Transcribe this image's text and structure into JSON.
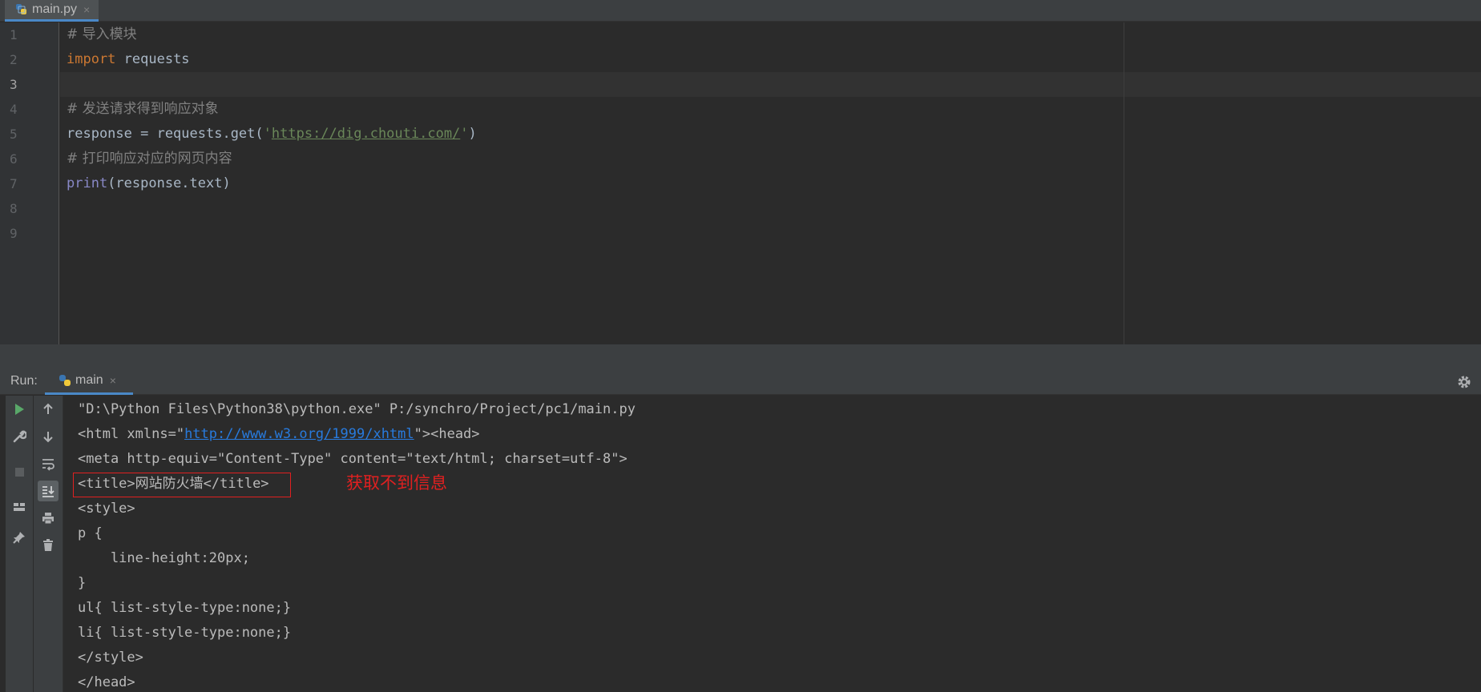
{
  "editor_tab": {
    "filename": "main.py",
    "close_glyph": "×",
    "icon": "python-file-icon"
  },
  "editor": {
    "line_numbers": [
      "1",
      "2",
      "3",
      "4",
      "5",
      "6",
      "7",
      "8",
      "9"
    ],
    "lines": {
      "l1_comment": "# 导入模块",
      "l2_kw": "import",
      "l2_rest": " requests",
      "l4_comment": "# 发送请求得到响应对象",
      "l5_pre": "response = requests.get(",
      "l5_quote_open": "'",
      "l5_url": "https://dig.chouti.com/",
      "l5_quote_close": "'",
      "l5_post": ")",
      "l6_comment": "# 打印响应对应的网页内容",
      "l7_builtin": "print",
      "l7_rest": "(response.text)"
    }
  },
  "run_panel": {
    "label": "Run:",
    "tab_name": "main",
    "close_glyph": "×",
    "settings_icon": "gear-icon"
  },
  "console": {
    "l1": "\"D:\\Python Files\\Python38\\python.exe\" P:/synchro/Project/pc1/main.py",
    "l2_pre": "<html xmlns=\"",
    "l2_link": "http://www.w3.org/1999/xhtml",
    "l2_post": "\"><head>",
    "l3": "<meta http-equiv=\"Content-Type\" content=\"text/html; charset=utf-8\">",
    "l4_open": "<title>",
    "l4_cjk": "网站防火墙",
    "l4_close": "</title>",
    "l5": "<style>",
    "l6": "p {",
    "l7": "    line-height:20px;",
    "l8": "}",
    "l9": "ul{ list-style-type:none;}",
    "l10": "li{ list-style-type:none;}",
    "l11": "</style>",
    "l12": "</head>"
  },
  "annotation": {
    "text": "获取不到信息",
    "color": "#e02020"
  },
  "colors": {
    "editor_bg": "#2b2b2b",
    "gutter_bg": "#313335",
    "keyword": "#cc7832",
    "string": "#6a8759",
    "comment": "#808080",
    "builtin": "#8888c6",
    "link": "#287bde"
  }
}
